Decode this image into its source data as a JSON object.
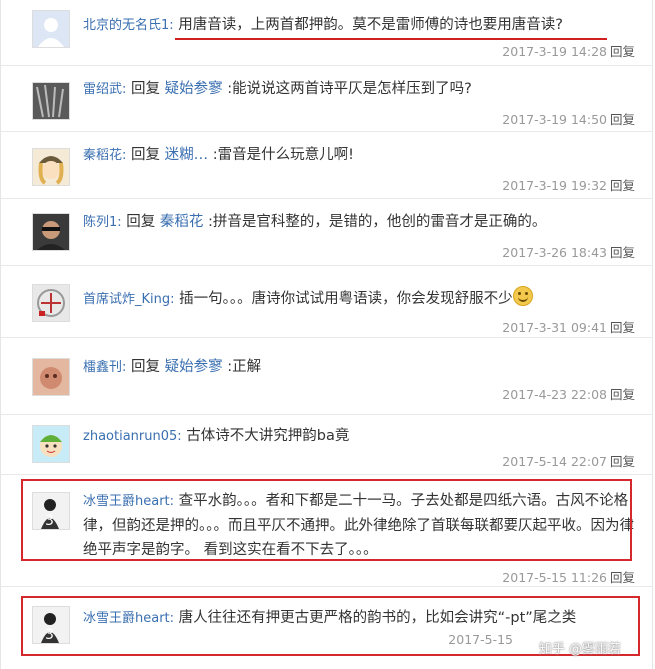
{
  "comments": [
    {
      "user": "北京的无名氏1:",
      "text": "用唐音读，上两首都押韵。莫不是雷师傅的诗也要用唐音读?",
      "date": "2017-3-19 14:28",
      "reply": "回复"
    },
    {
      "user": "雷绍武:",
      "reply_word": "回复",
      "target": "疑始参寥",
      "text": ":能说说这两首诗平仄是怎样压到了吗?",
      "date": "2017-3-19 14:50",
      "reply": "回复"
    },
    {
      "user": "秦稻花:",
      "reply_word": "回复",
      "target": "迷糊…",
      "text": ":雷音是什么玩意儿啊!",
      "date": "2017-3-19 19:32",
      "reply": "回复"
    },
    {
      "user": "陈列1:",
      "reply_word": "回复",
      "target": "秦稻花",
      "text": ":拼音是官科整的，是错的，他创的雷音才是正确的。",
      "date": "2017-3-26 18:43",
      "reply": "回复"
    },
    {
      "user": "首席试炸_King:",
      "text": "插一句。。。唐诗你试试用粤语读，你会发现舒服不少",
      "date": "2017-3-31 09:41",
      "reply": "回复"
    },
    {
      "user": "檑鑫刊:",
      "reply_word": "回复",
      "target": "疑始参寥",
      "text": ":正解",
      "date": "2017-4-23 22:08",
      "reply": "回复"
    },
    {
      "user": "zhaotianrun05:",
      "text": "古体诗不大讲究押韵ba竟",
      "date": "2017-5-14 22:07",
      "reply": "回复"
    },
    {
      "user": "冰雪王爵heart:",
      "text": "查平水韵。。。者和下都是二十一马。子去处都是四纸六语。古风不论格律，但韵还是押的。。。而且平仄不通押。此外律绝除了首联每联都要仄起平收。因为律绝平声字是韵字。 看到这实在看不下去了。。。",
      "date": "2017-5-15 11:26",
      "reply": "回复"
    },
    {
      "user": "冰雪王爵heart:",
      "text": "唐人往往还有押更古更严格的韵书的，比如会讲究“-pt”尾之类",
      "date": "2017-5-15"
    }
  ],
  "watermark": "知乎 @雾雨若",
  "colors": {
    "link": "#3a6fb0",
    "highlight": "#d4282d"
  }
}
